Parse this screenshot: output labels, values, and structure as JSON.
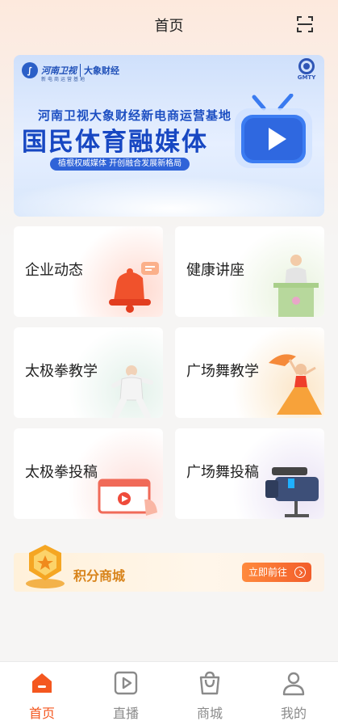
{
  "header": {
    "title": "首页"
  },
  "banner": {
    "logo_left": "河南卫视",
    "logo_left_brand": "大象财经",
    "logo_left_sub": "新电商运营基地",
    "logo_right": "GMTY",
    "subtitle": "河南卫视大象财经新电商运营基地",
    "title": "国民体育融媒体",
    "slogan": "植根权威媒体 开创融合发展新格局"
  },
  "cards": [
    {
      "label": "企业动态"
    },
    {
      "label": "健康讲座"
    },
    {
      "label": "太极拳教学"
    },
    {
      "label": "广场舞教学"
    },
    {
      "label": "太极拳投稿"
    },
    {
      "label": "广场舞投稿"
    }
  ],
  "points": {
    "label": "积分商城",
    "button": "立即前往"
  },
  "tabs": [
    {
      "label": "首页",
      "icon": "home-icon",
      "active": true
    },
    {
      "label": "直播",
      "icon": "live-icon",
      "active": false
    },
    {
      "label": "商城",
      "icon": "shop-bag-icon",
      "active": false
    },
    {
      "label": "我的",
      "icon": "user-icon",
      "active": false
    }
  ],
  "colors": {
    "accent": "#f4571f",
    "banner_blue": "#1747c2",
    "points_gold": "#d8831a"
  }
}
